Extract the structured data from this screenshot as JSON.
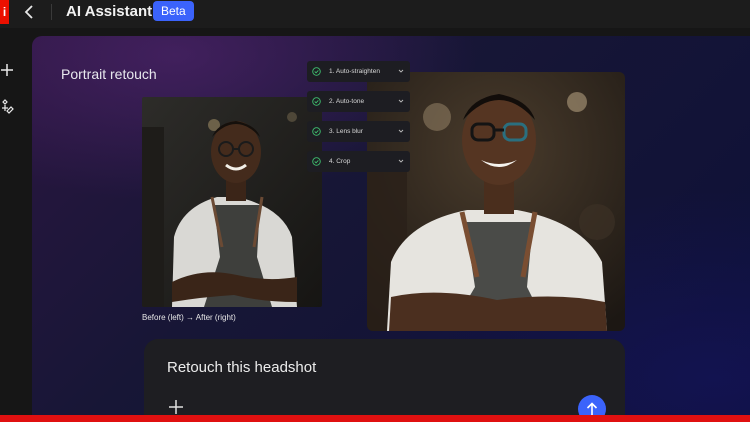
{
  "app": {
    "logo_letter": "i",
    "title": "AI Assistant",
    "badge": "Beta",
    "brand_color": "#eb1000",
    "accent_color": "#3b63fb"
  },
  "icons": {
    "back": "chevron-left-icon",
    "new": "plus-icon",
    "tools": "sparkle-icon",
    "attach": "plus-icon",
    "send": "arrow-up-icon",
    "step_status": "check-circle-icon",
    "step_expand": "chevron-down-icon"
  },
  "main": {
    "title": "Portrait retouch",
    "caption": "Before (left) → After (right)",
    "steps": [
      {
        "label": "1. Auto-straighten"
      },
      {
        "label": "2. Auto-tone"
      },
      {
        "label": "3. Lens blur"
      },
      {
        "label": "4. Crop"
      }
    ]
  },
  "prompt": {
    "text": "Retouch this headshot"
  }
}
